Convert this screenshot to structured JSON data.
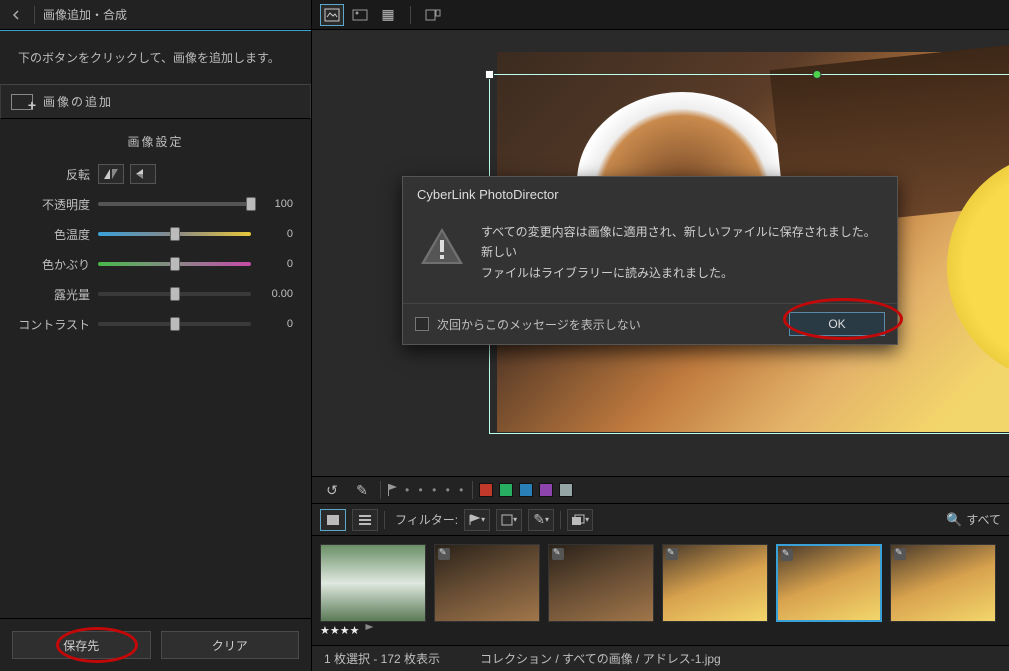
{
  "panel": {
    "title": "画像追加・合成",
    "hint": "下のボタンをクリックして、画像を追加します。",
    "add_label": "画像の追加",
    "section_title": "画像設定",
    "flip_label": "反転",
    "sliders": {
      "opacity": {
        "label": "不透明度",
        "value": "100",
        "pos": 100
      },
      "color_temp": {
        "label": "色温度",
        "value": "0",
        "pos": 50
      },
      "tint": {
        "label": "色かぶり",
        "value": "0",
        "pos": 50
      },
      "exposure": {
        "label": "露光量",
        "value": "0.00",
        "pos": 50
      },
      "contrast": {
        "label": "コントラスト",
        "value": "0",
        "pos": 50
      }
    },
    "footer": {
      "save": "保存先",
      "clear": "クリア"
    }
  },
  "dialog": {
    "title": "CyberLink PhotoDirector",
    "line1": "すべての変更内容は画像に適用され、新しいファイルに保存されました。新しい",
    "line2": "ファイルはライブラリーに読み込まれました。",
    "dont_show": "次回からこのメッセージを表示しない",
    "ok": "OK"
  },
  "filter": {
    "label": "フィルター:",
    "search": "すべて"
  },
  "colors": [
    "#c0392b",
    "#27ae60",
    "#2980b9",
    "#8e44ad",
    "#95a5a6"
  ],
  "status": {
    "text": "1 枚選択 - 172 枚表示",
    "breadcrumb": "コレクション / すべての画像 / アドレス-1.jpg"
  },
  "thumbs": {
    "stars": "★★★★"
  }
}
